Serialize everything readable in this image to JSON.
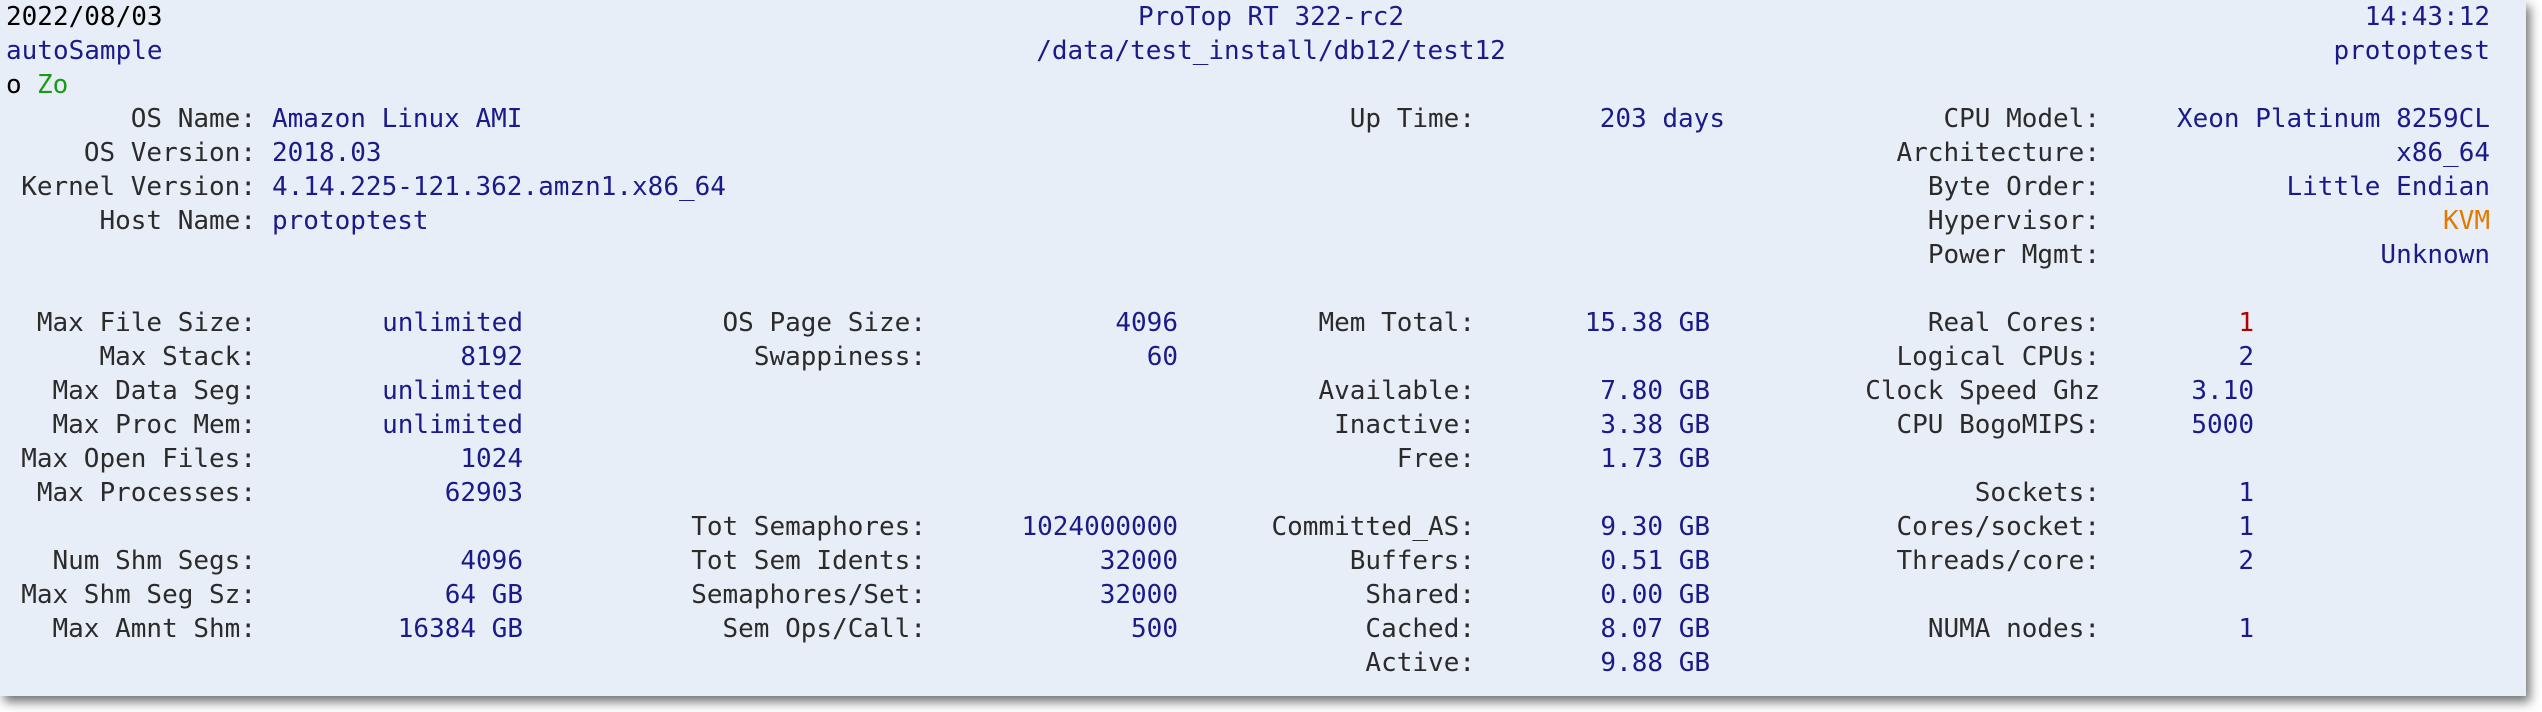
{
  "header": {
    "date": "2022/08/03",
    "title": "ProTop RT 322-rc2",
    "time": "14:43:12",
    "sample": "autoSample",
    "path": "/data/test_install/db12/test12",
    "host": "protoptest",
    "cmd_o": "o",
    "cmd_zo": "Zo"
  },
  "os": {
    "os_name_label": "OS Name:",
    "os_name": "Amazon Linux AMI",
    "os_version_label": "OS Version:",
    "os_version": "2018.03",
    "kernel_label": "Kernel Version:",
    "kernel": "4.14.225-121.362.amzn1.x86_64",
    "host_label": "Host Name:",
    "host": "protoptest",
    "uptime_label": "Up Time:",
    "uptime": "203 days"
  },
  "cpu_info": {
    "model_label": "CPU Model:",
    "model": "Xeon Platinum 8259CL",
    "arch_label": "Architecture:",
    "arch": "x86_64",
    "byteorder_label": "Byte Order:",
    "byteorder": "Little Endian",
    "hypervisor_label": "Hypervisor:",
    "hypervisor": "KVM",
    "power_label": "Power Mgmt:",
    "power": "Unknown"
  },
  "limits": {
    "max_file_size_label": "Max File Size:",
    "max_file_size": "unlimited",
    "max_stack_label": "Max Stack:",
    "max_stack": "8192",
    "max_data_seg_label": "Max Data Seg:",
    "max_data_seg": "unlimited",
    "max_proc_mem_label": "Max Proc Mem:",
    "max_proc_mem": "unlimited",
    "max_open_files_label": "Max Open Files:",
    "max_open_files": "1024",
    "max_processes_label": "Max Processes:",
    "max_processes": "62903",
    "num_shm_segs_label": "Num Shm Segs:",
    "num_shm_segs": "4096",
    "max_shm_seg_sz_label": "Max Shm Seg Sz:",
    "max_shm_seg_sz": "64 GB",
    "max_amnt_shm_label": "Max Amnt Shm:",
    "max_amnt_shm": "16384 GB"
  },
  "kernel_params": {
    "page_size_label": "OS Page Size:",
    "page_size": "4096",
    "swappiness_label": "Swappiness:",
    "swappiness": "60",
    "tot_sem_label": "Tot Semaphores:",
    "tot_sem": "1024000000",
    "tot_sem_idents_label": "Tot Sem Idents:",
    "tot_sem_idents": "32000",
    "sem_per_set_label": "Semaphores/Set:",
    "sem_per_set": "32000",
    "sem_ops_label": "Sem Ops/Call:",
    "sem_ops": "500"
  },
  "memory": {
    "total_label": "Mem Total:",
    "total": "15.38 GB",
    "available_label": "Available:",
    "available": "7.80 GB",
    "inactive_label": "Inactive:",
    "inactive": "3.38 GB",
    "free_label": "Free:",
    "free": "1.73 GB",
    "committed_label": "Committed_AS:",
    "committed": "9.30 GB",
    "buffers_label": "Buffers:",
    "buffers": "0.51 GB",
    "shared_label": "Shared:",
    "shared": "0.00 GB",
    "cached_label": "Cached:",
    "cached": "8.07 GB",
    "active_label": "Active:",
    "active": "9.88 GB"
  },
  "cpu": {
    "real_cores_label": "Real Cores:",
    "real_cores": "1",
    "logical_label": "Logical CPUs:",
    "logical": "2",
    "clock_label": "Clock Speed Ghz",
    "clock": "3.10",
    "bogomips_label": "CPU BogoMIPS:",
    "bogomips": "5000",
    "sockets_label": "Sockets:",
    "sockets": "1",
    "cores_socket_label": "Cores/socket:",
    "cores_socket": "1",
    "threads_core_label": "Threads/core:",
    "threads_core": "2",
    "numa_label": "NUMA nodes:",
    "numa": "1"
  },
  "colors": {
    "background": "#e8eef7",
    "value": "#1a1a8a",
    "label": "#2b2b2b",
    "alert_red": "#b00000",
    "hypervisor_orange": "#e07b00",
    "command_green": "#1a9a1a"
  }
}
